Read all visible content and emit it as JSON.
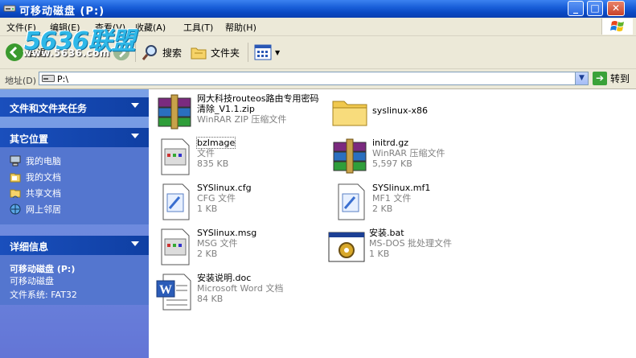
{
  "window": {
    "title": "可移动磁盘 (P:)",
    "controls": {
      "minimize": "_",
      "maximize": "□",
      "close": "✕"
    }
  },
  "watermark": {
    "logo": "5636联盟",
    "url": "www.5636.com"
  },
  "menu": {
    "items": [
      "文件(F)",
      "编辑(E)",
      "查看(V)",
      "收藏(A)",
      "工具(T)",
      "帮助(H)"
    ]
  },
  "toolbar": {
    "back_label": "后退",
    "search_label": "搜索",
    "folders_label": "文件夹"
  },
  "address": {
    "label": "地址(D)",
    "value": "P:\\",
    "go_label": "转到"
  },
  "left_panel": {
    "tasks_header": "文件和文件夹任务",
    "other_header": "其它位置",
    "other_items": [
      "我的电脑",
      "我的文档",
      "共享文档",
      "网上邻居"
    ],
    "details_header": "详细信息",
    "details_title": "可移动磁盘 (P:)",
    "details_type": "可移动磁盘",
    "details_fs": "文件系统: FAT32"
  },
  "files": [
    {
      "name": "网大科技routeos路由专用密码清除_V1.1.zip",
      "name_line1": "网大科技routeos路由专用密码",
      "name_line2": "清除_V1.1.zip",
      "type": "WinRAR ZIP 压缩文件",
      "size": "",
      "icon": "winrar-icon"
    },
    {
      "name": "syslinux-x86",
      "type": "",
      "size": "",
      "icon": "folder-icon"
    },
    {
      "name": "bzImage",
      "type": "文件",
      "size": "835 KB",
      "icon": "file-icon"
    },
    {
      "name": "initrd.gz",
      "type": "WinRAR 压缩文件",
      "size": "5,597 KB",
      "icon": "winrar-icon"
    },
    {
      "name": "SYSlinux.cfg",
      "type": "CFG 文件",
      "size": "1 KB",
      "icon": "config-file-icon"
    },
    {
      "name": "SYSlinux.mf1",
      "type": "MF1 文件",
      "size": "2 KB",
      "icon": "config-file-icon"
    },
    {
      "name": "SYSlinux.msg",
      "type": "MSG 文件",
      "size": "2 KB",
      "icon": "file-icon"
    },
    {
      "name": "安装.bat",
      "type": "MS-DOS 批处理文件",
      "size": "1 KB",
      "icon": "batch-file-icon"
    },
    {
      "name": "安装说明.doc",
      "type": "Microsoft Word 文档",
      "size": "84 KB",
      "icon": "word-doc-icon"
    }
  ],
  "colors": {
    "titlebar": "#0a4ac4",
    "panel_header": "#0f3fa3",
    "panel_body": "#5476cf",
    "panel_bg": "#7aa1e6",
    "chrome": "#ece9d8"
  }
}
